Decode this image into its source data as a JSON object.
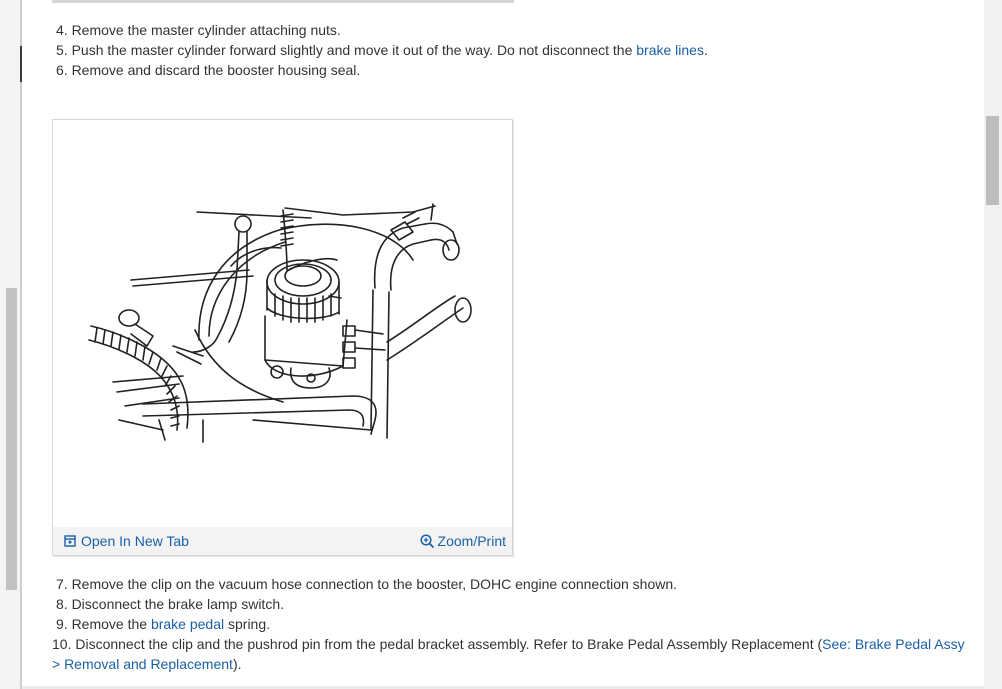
{
  "steps_top": [
    {
      "text": "4. Remove the master cylinder attaching nuts."
    },
    {
      "before": "5. Push the master cylinder forward slightly and move it out of the way. Do not disconnect the ",
      "link": "brake lines",
      "after": "."
    },
    {
      "text": "6. Remove and discard the booster housing seal."
    }
  ],
  "figure": {
    "open_tab_label": "Open In New Tab",
    "zoom_print_label": "Zoom/Print"
  },
  "steps_bottom": [
    {
      "text": "7. Remove the clip on the vacuum hose connection to the booster, DOHC engine connection shown."
    },
    {
      "text": "8. Disconnect the brake lamp switch."
    },
    {
      "before": "9. Remove the ",
      "link": "brake pedal",
      "after": " spring."
    },
    {
      "before": "10. Disconnect the clip and the pushrod pin from the pedal bracket assembly. Refer to Brake Pedal Assembly Replacement (",
      "link": "See: Brake Pedal Assy",
      "after": ""
    },
    {
      "link": "> Removal and Replacement",
      "after": ")."
    }
  ],
  "icons": {
    "open_tab": "open-in-new-tab-icon",
    "zoom": "zoom-in-icon"
  },
  "colors": {
    "link": "#1b5fa6",
    "text": "#333333"
  }
}
